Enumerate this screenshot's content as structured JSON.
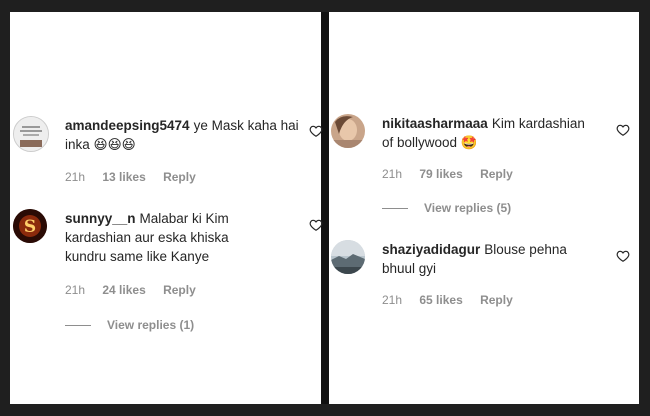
{
  "left": {
    "comments": [
      {
        "username": "amandeepsing5474",
        "text": "ye Mask kaha hai inka",
        "emojis": "😆😆😆",
        "time": "21h",
        "likes": "13 likes",
        "reply": "Reply",
        "avatar_icon": "mask-product-avatar"
      },
      {
        "username": "sunnyy__n",
        "text": "Malabar ki Kim kardashian aur eska khiska kundru same like Kanye",
        "time": "21h",
        "likes": "24 likes",
        "reply": "Reply",
        "view_replies": "View replies (1)",
        "avatar_icon": "letter-s-avatar"
      }
    ]
  },
  "right": {
    "comments": [
      {
        "username": "nikitaasharmaaa",
        "text": "Kim kardashian of bollywood",
        "emojis": "🤩",
        "time": "21h",
        "likes": "79 likes",
        "reply": "Reply",
        "view_replies": "View replies (5)",
        "avatar_icon": "portrait-avatar"
      },
      {
        "username": "shaziyadidagur",
        "text": "Blouse pehna bhuul gyi",
        "time": "21h",
        "likes": "65 likes",
        "reply": "Reply",
        "avatar_icon": "landscape-avatar"
      }
    ]
  },
  "colors": {
    "username": "#262626",
    "meta": "#8e8e8e",
    "background": "#ffffff",
    "frame": "#1f1f1f"
  }
}
